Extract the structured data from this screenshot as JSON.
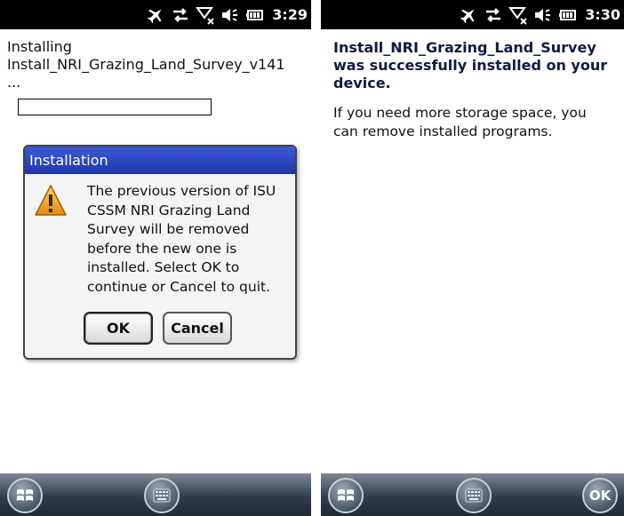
{
  "left_screen": {
    "status": {
      "time": "3:29"
    },
    "install": {
      "title": "Installing",
      "filename": "Install_NRI_Grazing_Land_Survey_v141",
      "dots": "...",
      "progress": 0
    },
    "dialog": {
      "title": "Installation",
      "message": "The previous version of ISU CSSM NRI Grazing Land Survey will be removed before the new one is installed. Select OK to continue or Cancel to quit.",
      "ok_label": "OK",
      "cancel_label": "Cancel"
    }
  },
  "right_screen": {
    "status": {
      "time": "3:30"
    },
    "done_title": "Install_NRI_Grazing_Land_Survey was successfully installed on your device.",
    "done_text": "If you need more storage space, you can remove installed programs.",
    "taskbar": {
      "ok_label": "OK"
    }
  },
  "icons": {
    "status": [
      "plane-icon",
      "sync-arrows-icon",
      "no-signal-icon",
      "volume-icon",
      "battery-icon"
    ],
    "taskbar": [
      "windows-start-icon",
      "keyboard-icon"
    ],
    "dialog": "warning-icon"
  },
  "colors": {
    "dialog_title_bar": "#2a47c2",
    "status_bar": "#000000",
    "taskbar": "#2f3c49",
    "done_title": "#0f1a44"
  }
}
